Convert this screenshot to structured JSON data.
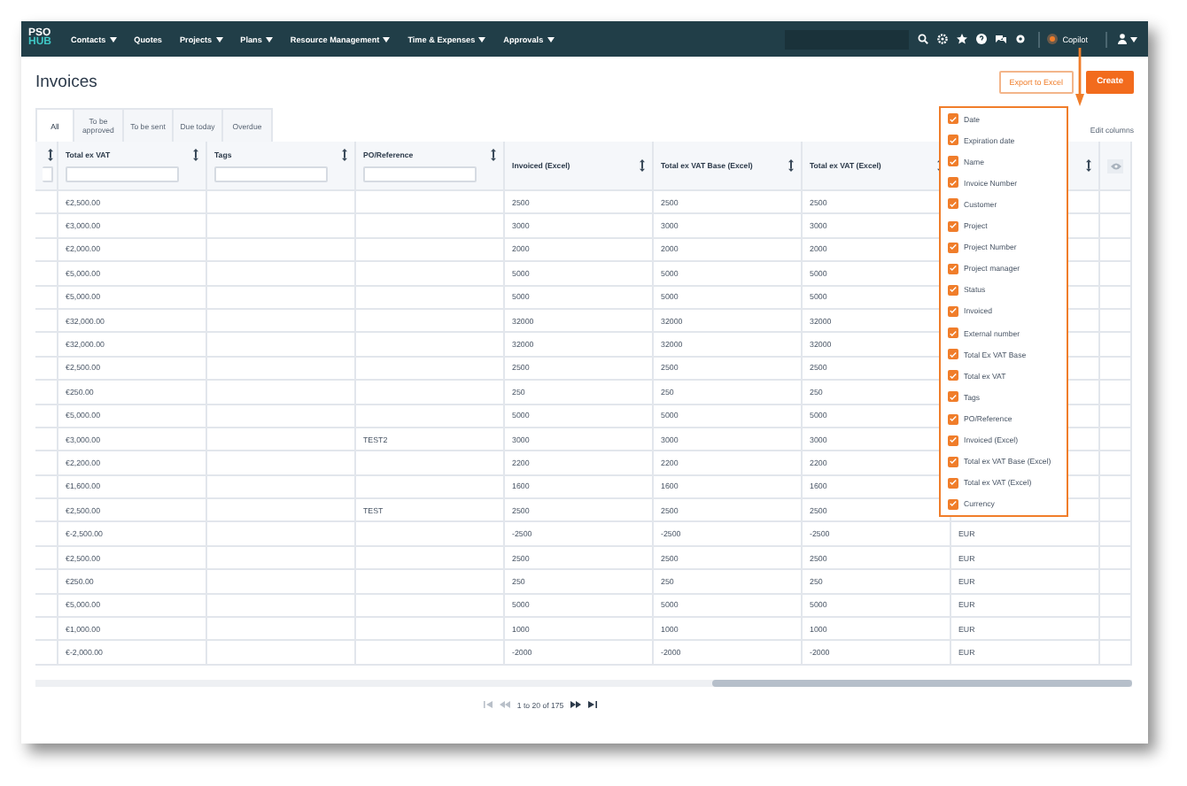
{
  "nav": {
    "logo_top": "PSO",
    "logo_bottom": "HUB",
    "items": [
      {
        "label": "Contacts",
        "dropdown": true
      },
      {
        "label": "Quotes",
        "dropdown": false
      },
      {
        "label": "Projects",
        "dropdown": true
      },
      {
        "label": "Plans",
        "dropdown": true
      },
      {
        "label": "Resource Management",
        "dropdown": true
      },
      {
        "label": "Time & Expenses",
        "dropdown": true
      },
      {
        "label": "Approvals",
        "dropdown": true
      }
    ],
    "copilot": "Copilot"
  },
  "title": "Invoices",
  "buttons": {
    "export": "Export to Excel",
    "create": "Create"
  },
  "tabs": [
    {
      "label": "All",
      "selected": true
    },
    {
      "label": "To be approved",
      "selected": false
    },
    {
      "label": "To be sent",
      "selected": false
    },
    {
      "label": "Due today",
      "selected": false
    },
    {
      "label": "Overdue",
      "selected": false
    }
  ],
  "edit_columns": "Edit columns",
  "table": {
    "columns": [
      {
        "filter": true
      },
      {
        "label": "Total ex VAT",
        "filter": true
      },
      {
        "label": "Tags",
        "filter": true
      },
      {
        "label": "PO/Reference",
        "filter": true
      },
      {
        "label": "Invoiced (Excel)",
        "filter": false
      },
      {
        "label": "Total ex VAT Base (Excel)",
        "filter": false
      },
      {
        "label": "Total ex VAT (Excel)",
        "filter": false
      },
      {
        "filter": false
      }
    ],
    "rows": [
      {
        "total_ex_vat": "€2,500.00",
        "invoiced_excel": "2500",
        "total_ex_vat_base_excel": "2500",
        "total_ex_vat_excel": "2500"
      },
      {
        "total_ex_vat": "€3,000.00",
        "invoiced_excel": "3000",
        "total_ex_vat_base_excel": "3000",
        "total_ex_vat_excel": "3000"
      },
      {
        "total_ex_vat": "€2,000.00",
        "invoiced_excel": "2000",
        "total_ex_vat_base_excel": "2000",
        "total_ex_vat_excel": "2000"
      },
      {
        "total_ex_vat": "€5,000.00",
        "invoiced_excel": "5000",
        "total_ex_vat_base_excel": "5000",
        "total_ex_vat_excel": "5000"
      },
      {
        "total_ex_vat": "€5,000.00",
        "invoiced_excel": "5000",
        "total_ex_vat_base_excel": "5000",
        "total_ex_vat_excel": "5000"
      },
      {
        "total_ex_vat": "€32,000.00",
        "invoiced_excel": "32000",
        "total_ex_vat_base_excel": "32000",
        "total_ex_vat_excel": "32000"
      },
      {
        "total_ex_vat": "€32,000.00",
        "invoiced_excel": "32000",
        "total_ex_vat_base_excel": "32000",
        "total_ex_vat_excel": "32000"
      },
      {
        "total_ex_vat": "€2,500.00",
        "invoiced_excel": "2500",
        "total_ex_vat_base_excel": "2500",
        "total_ex_vat_excel": "2500"
      },
      {
        "total_ex_vat": "€250.00",
        "invoiced_excel": "250",
        "total_ex_vat_base_excel": "250",
        "total_ex_vat_excel": "250"
      },
      {
        "total_ex_vat": "€5,000.00",
        "invoiced_excel": "5000",
        "total_ex_vat_base_excel": "5000",
        "total_ex_vat_excel": "5000"
      },
      {
        "total_ex_vat": "€3,000.00",
        "po_reference": "TEST2",
        "invoiced_excel": "3000",
        "total_ex_vat_base_excel": "3000",
        "total_ex_vat_excel": "3000"
      },
      {
        "total_ex_vat": "€2,200.00",
        "invoiced_excel": "2200",
        "total_ex_vat_base_excel": "2200",
        "total_ex_vat_excel": "2200"
      },
      {
        "total_ex_vat": "€1,600.00",
        "invoiced_excel": "1600",
        "total_ex_vat_base_excel": "1600",
        "total_ex_vat_excel": "1600"
      },
      {
        "total_ex_vat": "€2,500.00",
        "po_reference": "TEST",
        "invoiced_excel": "2500",
        "total_ex_vat_base_excel": "2500",
        "total_ex_vat_excel": "2500"
      },
      {
        "total_ex_vat": "€-2,500.00",
        "invoiced_excel": "-2500",
        "total_ex_vat_base_excel": "-2500",
        "total_ex_vat_excel": "-2500",
        "column_8": "EUR"
      },
      {
        "total_ex_vat": "€2,500.00",
        "invoiced_excel": "2500",
        "total_ex_vat_base_excel": "2500",
        "total_ex_vat_excel": "2500",
        "column_8": "EUR"
      },
      {
        "total_ex_vat": "€250.00",
        "invoiced_excel": "250",
        "total_ex_vat_base_excel": "250",
        "total_ex_vat_excel": "250",
        "column_8": "EUR"
      },
      {
        "total_ex_vat": "€5,000.00",
        "invoiced_excel": "5000",
        "total_ex_vat_base_excel": "5000",
        "total_ex_vat_excel": "5000",
        "column_8": "EUR"
      },
      {
        "total_ex_vat": "€1,000.00",
        "invoiced_excel": "1000",
        "total_ex_vat_base_excel": "1000",
        "total_ex_vat_excel": "1000",
        "column_8": "EUR"
      },
      {
        "total_ex_vat": "€-2,000.00",
        "invoiced_excel": "-2000",
        "total_ex_vat_base_excel": "-2000",
        "total_ex_vat_excel": "-2000",
        "column_8": "EUR"
      }
    ]
  },
  "column_chooser": [
    {
      "label": "Date",
      "checked": true
    },
    {
      "label": "Expiration date",
      "checked": true
    },
    {
      "label": "Name",
      "checked": true
    },
    {
      "label": "Invoice Number",
      "checked": true
    },
    {
      "label": "Customer",
      "checked": true
    },
    {
      "label": "Project",
      "checked": true
    },
    {
      "label": "Project Number",
      "checked": true
    },
    {
      "label": "Project manager",
      "checked": true
    },
    {
      "label": "Status",
      "checked": true
    },
    {
      "label": "Invoiced",
      "checked": true
    },
    {
      "label": "External number",
      "checked": true
    },
    {
      "label": "Total Ex VAT Base",
      "checked": true
    },
    {
      "label": "Total ex VAT",
      "checked": true
    },
    {
      "label": "Tags",
      "checked": true
    },
    {
      "label": "PO/Reference",
      "checked": true
    },
    {
      "label": "Invoiced (Excel)",
      "checked": true
    },
    {
      "label": "Total ex VAT Base (Excel)",
      "checked": true
    },
    {
      "label": "Total ex VAT (Excel)",
      "checked": true
    },
    {
      "label": "Currency",
      "checked": true
    }
  ],
  "pagination": {
    "label": "1 to 20 of 175",
    "first_disabled": true,
    "previous_disabled": true,
    "next_disabled": false,
    "last_disabled": false
  }
}
